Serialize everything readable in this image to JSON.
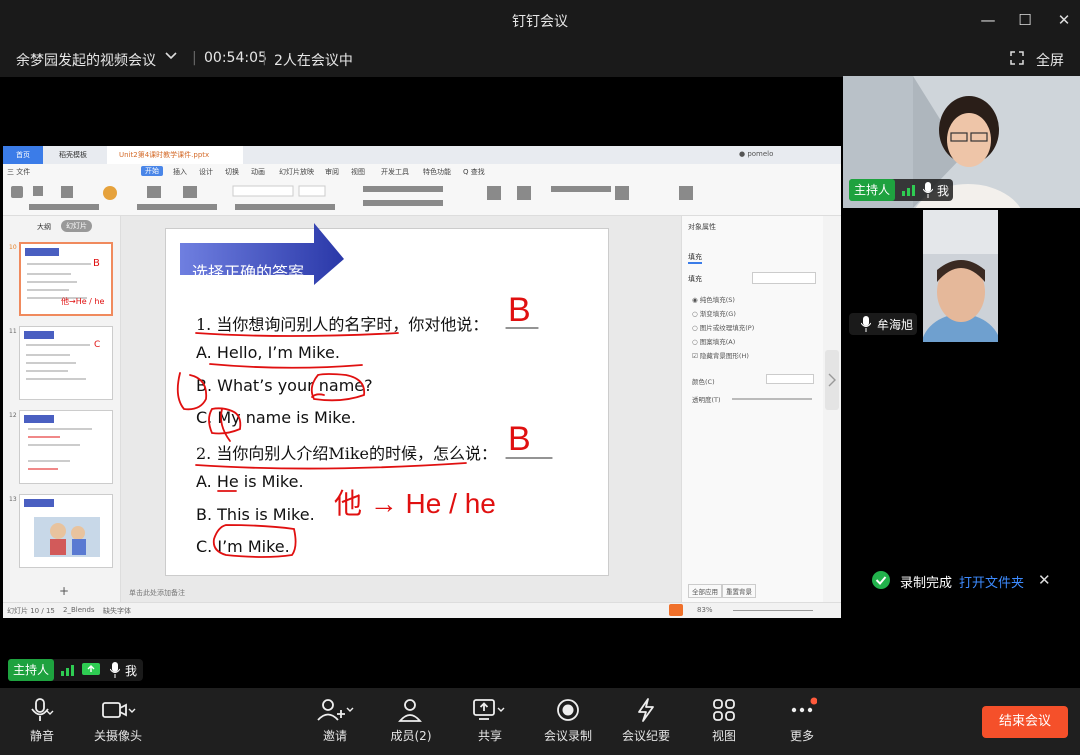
{
  "window": {
    "title": "钉钉会议"
  },
  "meeting": {
    "name": "余梦园发起的视频会议",
    "duration": "00:54:05",
    "participants_text": "2人在会议中",
    "fullscreen_label": "全屏"
  },
  "ppt": {
    "tabs": [
      "首页",
      "稻壳模板",
      "Unit2第4课时教学课件.pptx"
    ],
    "menu": [
      "三 文件",
      "开始",
      "插入",
      "设计",
      "切换",
      "动画",
      "幻灯片放映",
      "审阅",
      "视图",
      "开发工具",
      "特色功能",
      "Q 查找"
    ],
    "pane_tabs": [
      "大纲",
      "幻灯片"
    ],
    "status_left": "幻灯片 10 / 15",
    "status_theme": "2_Blends",
    "status_font": "缺失字体",
    "notes_hint": "单击此处添加备注",
    "zoom": "83%",
    "thumb_numbers": [
      "10",
      "11",
      "12",
      "13"
    ],
    "right_panel_title": "对象属性",
    "right_panel_tab": "填充",
    "right_panel_section": "填充",
    "fill_options": [
      "纯色填充(S)",
      "渐变填充(G)",
      "图片或纹理填充(P)",
      "图案填充(A)",
      "隐藏背景图形(H)"
    ],
    "color_label": "颜色(C)",
    "transparency_label": "透明度(T)",
    "panel_buttons": [
      "全部应用",
      "重置背景"
    ]
  },
  "slide": {
    "header": "选择正确的答案",
    "q1": "1. 当你想询问别人的名字时，你对他说：",
    "q1_a": "A.  Hello, I’m Mike.",
    "q1_b": "B.  What’s your name?",
    "q1_c": "C. My name is Mike.",
    "q2": "2. 当你向别人介绍Mike的时候，怎么说：",
    "q2_a": "A. He is Mike.",
    "q2_b": "B. This is Mike.",
    "q2_c": "C. I’m Mike.",
    "answer1": "B",
    "answer2": "B",
    "annotation": "他 → He / he"
  },
  "videos": {
    "host_label": "主持人",
    "me_label": "我",
    "second_name": "牟海旭"
  },
  "recording": {
    "done_text": "录制完成",
    "link_text": "打开文件夹"
  },
  "self_tag": {
    "host_label": "主持人",
    "me_label": "我"
  },
  "toolbar": {
    "mute": "静音",
    "camera": "关摄像头",
    "invite": "邀请",
    "members": "成员(2)",
    "share": "共享",
    "record": "会议录制",
    "minutes": "会议纪要",
    "view": "视图",
    "more": "更多",
    "end": "结束会议"
  },
  "colors": {
    "host_green": "#1ea23f",
    "end_red": "#f5502a",
    "link_blue": "#3d8bff",
    "ink_red": "#e01010"
  }
}
